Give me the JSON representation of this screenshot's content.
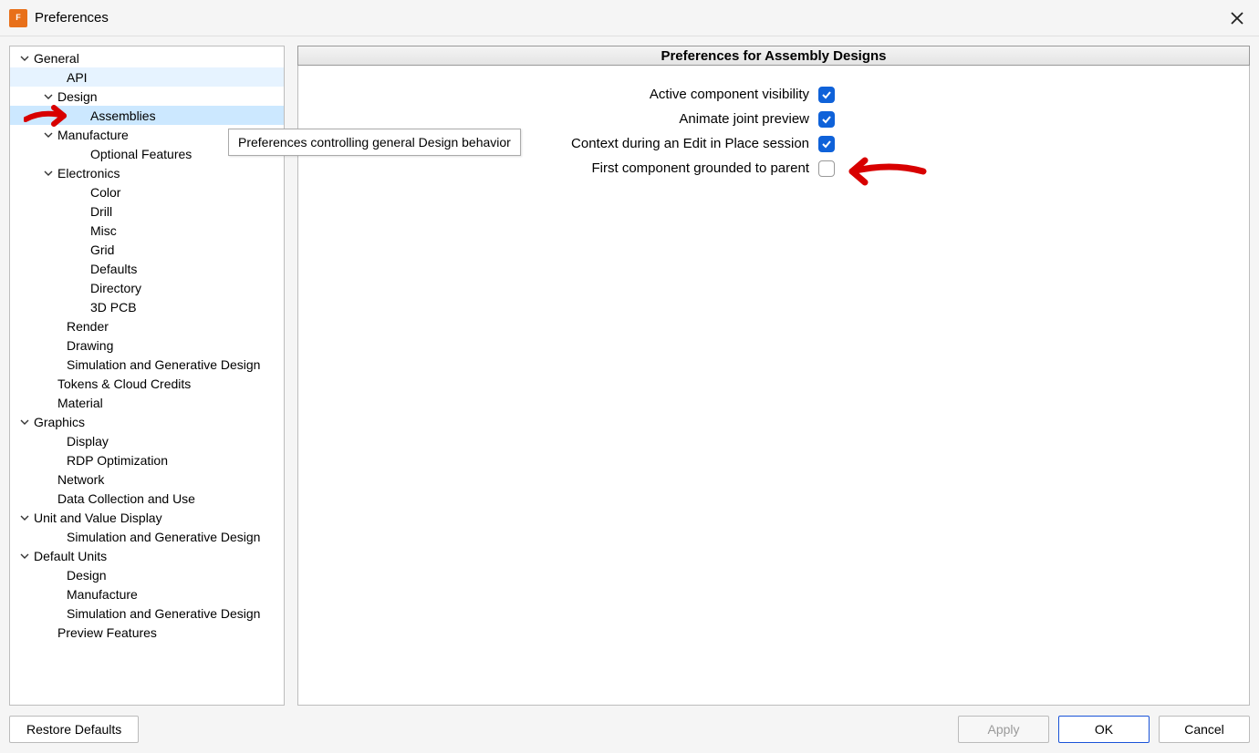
{
  "window": {
    "title": "Preferences"
  },
  "tree": {
    "general": "General",
    "api": "API",
    "design": "Design",
    "assemblies": "Assemblies",
    "manufacture": "Manufacture",
    "optional_features": "Optional Features",
    "electronics": "Electronics",
    "color": "Color",
    "drill": "Drill",
    "misc": "Misc",
    "grid": "Grid",
    "defaults": "Defaults",
    "directory": "Directory",
    "pcb3d": "3D PCB",
    "render": "Render",
    "drawing": "Drawing",
    "sim_gen": "Simulation and Generative Design",
    "tokens": "Tokens & Cloud Credits",
    "material": "Material",
    "graphics": "Graphics",
    "display": "Display",
    "rdp": "RDP Optimization",
    "network": "Network",
    "data_collection": "Data Collection and Use",
    "unit_value": "Unit and Value Display",
    "sim_gen2": "Simulation and Generative Design",
    "default_units": "Default Units",
    "design2": "Design",
    "manufacture2": "Manufacture",
    "sim_gen3": "Simulation and Generative Design",
    "preview_features": "Preview Features"
  },
  "content": {
    "header": "Preferences for Assembly Designs",
    "rows": [
      {
        "label": "Active component visibility",
        "checked": true
      },
      {
        "label": "Animate joint preview",
        "checked": true
      },
      {
        "label": "Context during an Edit in Place session",
        "checked": true
      },
      {
        "label": "First component grounded to parent",
        "checked": false
      }
    ]
  },
  "tooltip": "Preferences controlling general Design behavior",
  "footer": {
    "restore": "Restore Defaults",
    "apply": "Apply",
    "ok": "OK",
    "cancel": "Cancel"
  }
}
